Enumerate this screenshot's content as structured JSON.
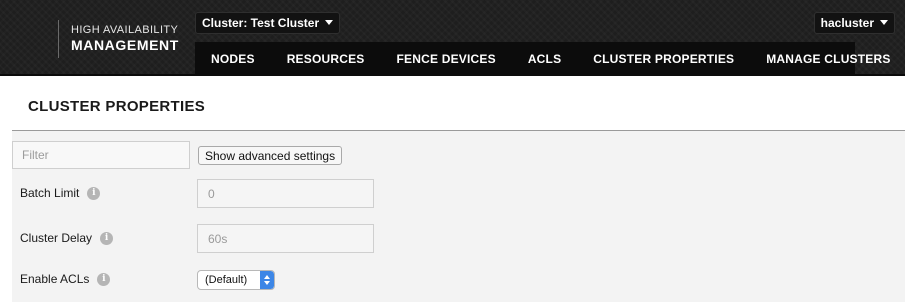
{
  "brand": {
    "top": "HIGH AVAILABILITY",
    "bottom": "MANAGEMENT"
  },
  "cluster_selector": {
    "label": "Cluster: Test Cluster",
    "icon": "chevron-down-icon"
  },
  "user_menu": {
    "label": "hacluster",
    "icon": "chevron-down-icon"
  },
  "nav": {
    "items": [
      {
        "label": "NODES"
      },
      {
        "label": "RESOURCES"
      },
      {
        "label": "FENCE DEVICES"
      },
      {
        "label": "ACLS"
      },
      {
        "label": "CLUSTER PROPERTIES"
      },
      {
        "label": "MANAGE CLUSTERS"
      }
    ],
    "active": "CLUSTER PROPERTIES"
  },
  "page": {
    "title": "CLUSTER PROPERTIES"
  },
  "filter": {
    "placeholder": "Filter",
    "value": ""
  },
  "advanced_button": {
    "label": "Show advanced settings"
  },
  "properties": [
    {
      "label": "Batch Limit",
      "info_icon": "i",
      "placeholder": "0"
    },
    {
      "label": "Cluster Delay",
      "info_icon": "i",
      "placeholder": "60s"
    },
    {
      "label": "Enable ACLs",
      "info_icon": "i",
      "selected": "(Default)"
    }
  ],
  "colors": {
    "header_bg": "#1e1e1e",
    "nav_bg": "#0c0c0c",
    "panel_bg": "#f3f3f3",
    "select_accent": "#3d86e6"
  }
}
